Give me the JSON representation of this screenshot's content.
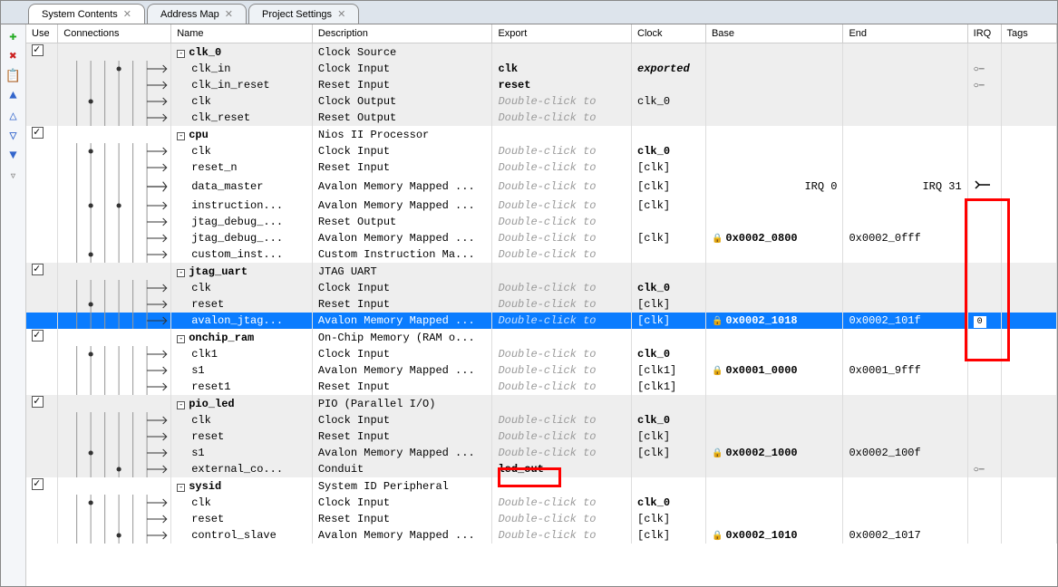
{
  "tabs": [
    {
      "label": "System Contents",
      "active": true
    },
    {
      "label": "Address Map",
      "active": false
    },
    {
      "label": "Project Settings",
      "active": false
    }
  ],
  "headers": {
    "use": "Use",
    "connections": "Connections",
    "name": "Name",
    "description": "Description",
    "export": "Export",
    "clock": "Clock",
    "base": "Base",
    "end": "End",
    "irq": "IRQ",
    "tags": "Tags"
  },
  "dbl_click": "Double-click to",
  "irq_labels": {
    "irq0": "IRQ 0",
    "irq31": "IRQ 31"
  },
  "rows": [
    {
      "type": "parent",
      "use": true,
      "name": "clk_0",
      "desc": "Clock Source",
      "shade": "even"
    },
    {
      "type": "child",
      "name": "clk_in",
      "desc": "Clock Input",
      "export": "clk",
      "export_bold": true,
      "clock": "exported",
      "clock_italic": true,
      "shade": "even",
      "irq_pin": true
    },
    {
      "type": "child",
      "name": "clk_in_reset",
      "desc": "Reset Input",
      "export": "reset",
      "export_bold": true,
      "shade": "even",
      "irq_pin": true
    },
    {
      "type": "child",
      "name": "clk",
      "desc": "Clock Output",
      "export_dbl": true,
      "clock": "clk_0",
      "shade": "even"
    },
    {
      "type": "child",
      "name": "clk_reset",
      "desc": "Reset Output",
      "export_dbl": true,
      "shade": "even"
    },
    {
      "type": "parent",
      "use": true,
      "name": "cpu",
      "desc": "Nios II Processor",
      "shade": "odd"
    },
    {
      "type": "child",
      "name": "clk",
      "desc": "Clock Input",
      "export_dbl": true,
      "clock": "clk_0",
      "clock_bold": true,
      "shade": "odd"
    },
    {
      "type": "child",
      "name": "reset_n",
      "desc": "Reset Input",
      "export_dbl": true,
      "clock": "[clk]",
      "shade": "odd"
    },
    {
      "type": "child",
      "name": "data_master",
      "desc": "Avalon Memory Mapped ...",
      "export_dbl": true,
      "clock": "[clk]",
      "base": "IRQ 0",
      "end": "IRQ 31",
      "shade": "odd",
      "irq_arrow": true
    },
    {
      "type": "child",
      "name": "instruction...",
      "desc": "Avalon Memory Mapped ...",
      "export_dbl": true,
      "clock": "[clk]",
      "shade": "odd"
    },
    {
      "type": "child",
      "name": "jtag_debug_...",
      "desc": "Reset Output",
      "export_dbl": true,
      "shade": "odd"
    },
    {
      "type": "child",
      "name": "jtag_debug_...",
      "desc": "Avalon Memory Mapped ...",
      "export_dbl": true,
      "clock": "[clk]",
      "base": "0x0002_0800",
      "base_bold": true,
      "base_lock": true,
      "end": "0x0002_0fff",
      "shade": "odd"
    },
    {
      "type": "child",
      "name": "custom_inst...",
      "desc": "Custom Instruction Ma...",
      "export_dbl": true,
      "shade": "odd"
    },
    {
      "type": "parent",
      "use": true,
      "name": "jtag_uart",
      "desc": "JTAG UART",
      "shade": "even"
    },
    {
      "type": "child",
      "name": "clk",
      "desc": "Clock Input",
      "export_dbl": true,
      "clock": "clk_0",
      "clock_bold": true,
      "shade": "even"
    },
    {
      "type": "child",
      "name": "reset",
      "desc": "Reset Input",
      "export_dbl": true,
      "clock": "[clk]",
      "shade": "even"
    },
    {
      "type": "child",
      "name": "avalon_jtag...",
      "desc": "Avalon Memory Mapped ...",
      "export_dbl": true,
      "clock": "[clk]",
      "base": "0x0002_1018",
      "base_bold": true,
      "base_lock": true,
      "end": "0x0002_101f",
      "shade": "selected",
      "irq_val": "0"
    },
    {
      "type": "parent",
      "use": true,
      "name": "onchip_ram",
      "desc": "On-Chip Memory (RAM o...",
      "shade": "odd"
    },
    {
      "type": "child",
      "name": "clk1",
      "desc": "Clock Input",
      "export_dbl": true,
      "clock": "clk_0",
      "clock_bold": true,
      "shade": "odd"
    },
    {
      "type": "child",
      "name": "s1",
      "desc": "Avalon Memory Mapped ...",
      "export_dbl": true,
      "clock": "[clk1]",
      "base": "0x0001_0000",
      "base_bold": true,
      "base_lock": true,
      "end": "0x0001_9fff",
      "shade": "odd"
    },
    {
      "type": "child",
      "name": "reset1",
      "desc": "Reset Input",
      "export_dbl": true,
      "clock": "[clk1]",
      "shade": "odd"
    },
    {
      "type": "parent",
      "use": true,
      "name": "pio_led",
      "desc": "PIO (Parallel I/O)",
      "shade": "even"
    },
    {
      "type": "child",
      "name": "clk",
      "desc": "Clock Input",
      "export_dbl": true,
      "clock": "clk_0",
      "clock_bold": true,
      "shade": "even"
    },
    {
      "type": "child",
      "name": "reset",
      "desc": "Reset Input",
      "export_dbl": true,
      "clock": "[clk]",
      "shade": "even"
    },
    {
      "type": "child",
      "name": "s1",
      "desc": "Avalon Memory Mapped ...",
      "export_dbl": true,
      "clock": "[clk]",
      "base": "0x0002_1000",
      "base_bold": true,
      "base_lock": true,
      "end": "0x0002_100f",
      "shade": "even"
    },
    {
      "type": "child",
      "name": "external_co...",
      "desc": "Conduit",
      "export": "led_out",
      "export_bold": true,
      "export_highlight": true,
      "shade": "even",
      "irq_pin": true
    },
    {
      "type": "parent",
      "use": true,
      "name": "sysid",
      "desc": "System ID Peripheral",
      "shade": "odd"
    },
    {
      "type": "child",
      "name": "clk",
      "desc": "Clock Input",
      "export_dbl": true,
      "clock": "clk_0",
      "clock_bold": true,
      "shade": "odd"
    },
    {
      "type": "child",
      "name": "reset",
      "desc": "Reset Input",
      "export_dbl": true,
      "clock": "[clk]",
      "shade": "odd"
    },
    {
      "type": "child",
      "name": "control_slave",
      "desc": "Avalon Memory Mapped ...",
      "export_dbl": true,
      "clock": "[clk]",
      "base": "0x0002_1010",
      "base_bold": true,
      "base_lock": true,
      "end": "0x0002_1017",
      "shade": "odd"
    }
  ],
  "toolbar_icons": [
    "plus",
    "x",
    "clipboard",
    "up-all",
    "up",
    "down",
    "down-all",
    "filter"
  ]
}
